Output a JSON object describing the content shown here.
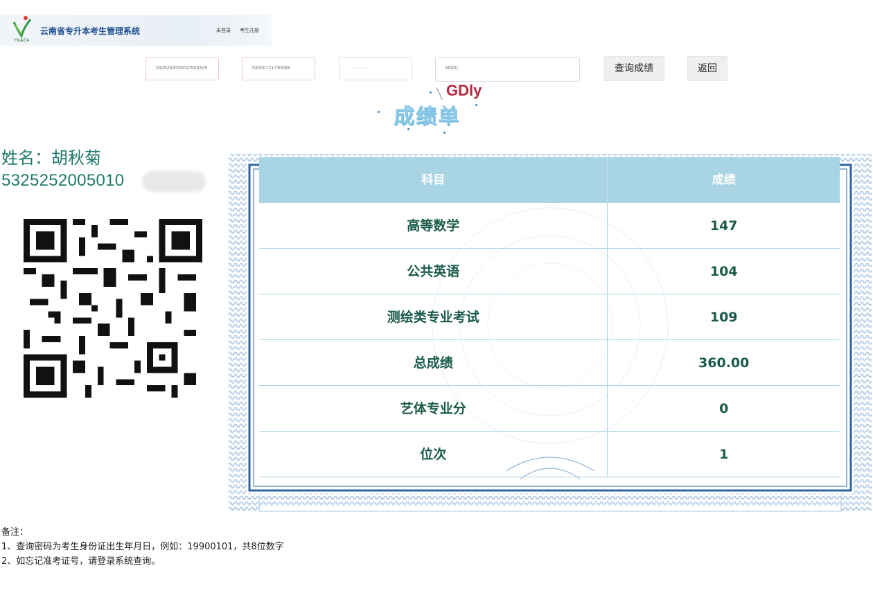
{
  "header": {
    "logo_text": "YNAEA",
    "site_title": "云南省专升本考生管理系统",
    "nav_login": "未登录",
    "nav_register": "考生注册"
  },
  "query_form": {
    "exam_no_value": "5325252005010503329",
    "id_value": "5326012173006​9",
    "password_value": "·········",
    "captcha_input_value": "Md2C",
    "query_button": "查询成绩",
    "back_button": "返回"
  },
  "captcha_image_text": "GDly",
  "report_title": "成绩单",
  "candidate": {
    "name_line": "姓名：胡秋菊",
    "id_line": "5325252005010"
  },
  "scores": {
    "headers": [
      "科目",
      "成绩"
    ],
    "rows": [
      {
        "subject": "高等数学",
        "score": "147"
      },
      {
        "subject": "公共英语",
        "score": "104"
      },
      {
        "subject": "测绘类专业考试",
        "score": "109"
      },
      {
        "subject": "总成绩",
        "score": "360.00"
      },
      {
        "subject": "艺体专业分",
        "score": "0"
      },
      {
        "subject": "位次",
        "score": "1"
      }
    ]
  },
  "notes": {
    "label": "备注：",
    "line1": "1、查询密码为考生身份证出生年月日，例如：19900101，共8位数字",
    "line2": "2、如忘记准考证号，请登录系统查询。"
  },
  "colors": {
    "accent_teal": "#1f7a6a",
    "header_blue": "#a8d4e3",
    "border_blue": "#2e64a6",
    "captcha_red": "#b3293d"
  }
}
